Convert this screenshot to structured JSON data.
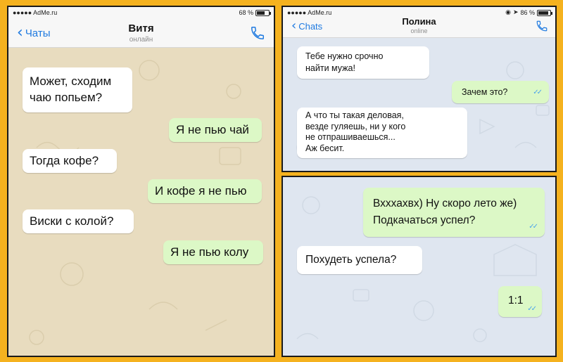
{
  "left_chat": {
    "status": {
      "carrier": "●●●●● AdMe.ru",
      "battery": "68 %",
      "battery_level": 0.68
    },
    "header": {
      "back_label": "Чаты",
      "name": "Витя",
      "presence": "онлайн"
    },
    "messages": [
      {
        "dir": "in",
        "text": "Может, сходим\nчаю попьем?"
      },
      {
        "dir": "out",
        "text": "Я не пью чай"
      },
      {
        "dir": "in",
        "text": "Тогда кофе?"
      },
      {
        "dir": "out",
        "text": "И кофе я не пью"
      },
      {
        "dir": "in",
        "text": "Виски с колой?"
      },
      {
        "dir": "out",
        "text": "Я не пью колу"
      }
    ]
  },
  "top_right_chat": {
    "status": {
      "carrier": "●●●●● AdMe.ru",
      "battery": "86 %",
      "battery_level": 0.86
    },
    "header": {
      "back_label": "Chats",
      "name": "Полина",
      "presence": "online"
    },
    "messages": [
      {
        "dir": "in",
        "text": "Тебе нужно срочно\nнайти мужа!"
      },
      {
        "dir": "out",
        "text": "Зачем это?"
      },
      {
        "dir": "in",
        "text": "А что ты такая деловая,\nвезде гуляешь, ни у кого\nне отпрашиваешься...\nАж бесит."
      }
    ]
  },
  "bottom_right_chat": {
    "messages": [
      {
        "dir": "out",
        "text": "Вхххахвх) Ну скоро лето же)\nПодкачаться успел?"
      },
      {
        "dir": "in",
        "text": "Похудеть успела?"
      },
      {
        "dir": "out",
        "text": "1:1"
      }
    ]
  },
  "colors": {
    "frame": "#f5b21f",
    "left_wallpaper": "#e8dcbf",
    "right_wallpaper": "#dfe6f0",
    "incoming_bubble": "#ffffff",
    "outgoing_bubble": "#dcf8c6",
    "accent": "#1f7ae0",
    "read_ticks": "#4aa3ec"
  },
  "icons": [
    "chevron-left-icon",
    "phone-icon",
    "double-check-icon",
    "battery-icon",
    "location-arrow-icon",
    "eye-icon"
  ]
}
